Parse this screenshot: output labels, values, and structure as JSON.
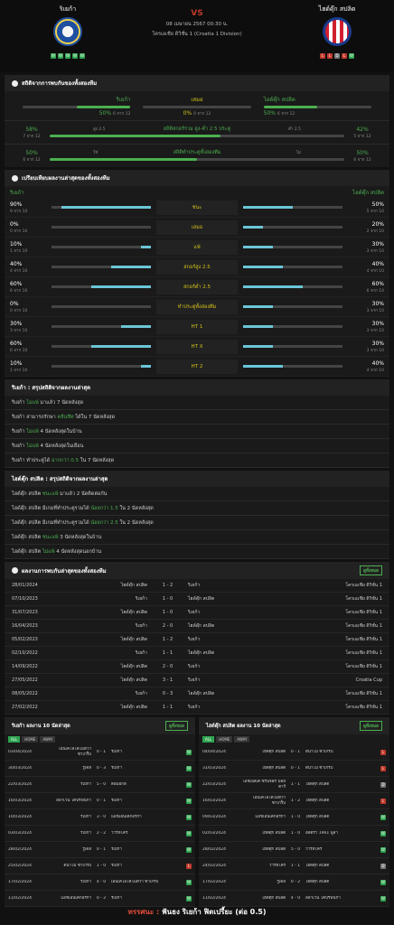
{
  "header": {
    "home": "ริเยก้า",
    "away": "ไฮด์ดุ๊ก สปลิต",
    "vs": "VS",
    "date": "08 เมษายน 2567 00:30 น.",
    "league": "โครเอเชีย ดิวิชั่น 1 (Croatia 1 Division)",
    "home_form": [
      "W",
      "W",
      "W",
      "W",
      "W"
    ],
    "away_form": [
      "L",
      "L",
      "D",
      "L",
      "W"
    ]
  },
  "h2h": {
    "title": "สถิติจากการพบกันของทั้งสองทีม",
    "labels": {
      "home": "ริเยก้า",
      "draw": "เสมอ",
      "away": "ไฮด์ดุ๊ก สปลิต"
    },
    "home_pct": "50%",
    "home_of": "6 จาก 12",
    "draw_pct": "0%",
    "draw_of": "0 จาก 12",
    "away_pct": "50%",
    "away_of": "6 จาก 12",
    "home_fill": 0.5,
    "draw_fill": 0,
    "away_fill": 0.5,
    "ou": {
      "left_pct": "58%",
      "left_of": "7 จาก 12",
      "left_lbl": "สูง 2.5",
      "center": "สถิติสกอร์รวม สูง-ต่ำ 2.5 ประตู",
      "right_lbl": "ต่ำ 2.5",
      "right_pct": "42%",
      "right_of": "5 จาก 12",
      "fill": 0.58
    },
    "bt": {
      "left_pct": "50%",
      "left_of": "6 จาก 12",
      "left_lbl": "ใช่",
      "center": "สถิติทำประตูทั้งสองทีม",
      "right_lbl": "ไม่",
      "right_pct": "50%",
      "right_of": "6 จาก 12",
      "fill": 0.5
    }
  },
  "recent": {
    "title": "เปรียบเทียบผลงานล่าสุดของทั้งสองทีม",
    "home": "ริเยก้า",
    "away": "ไฮด์ดุ๊ก สปลิต",
    "rows": [
      {
        "label": "ชนะ",
        "lp": "90%",
        "lo": "9 จาก 10",
        "lf": 0.9,
        "rp": "50%",
        "ro": "5 จาก 10",
        "rf": 0.5
      },
      {
        "label": "เสมอ",
        "lp": "0%",
        "lo": "0 จาก 10",
        "lf": 0,
        "rp": "20%",
        "ro": "2 จาก 10",
        "rf": 0.2
      },
      {
        "label": "แพ้",
        "lp": "10%",
        "lo": "1 จาก 10",
        "lf": 0.1,
        "rp": "30%",
        "ro": "3 จาก 10",
        "rf": 0.3
      },
      {
        "label": "สกอร์สูง 2.5",
        "lp": "40%",
        "lo": "4 จาก 10",
        "lf": 0.4,
        "rp": "40%",
        "ro": "4 จาก 10",
        "rf": 0.4
      },
      {
        "label": "สกอร์ต่ำ 2.5",
        "lp": "60%",
        "lo": "6 จาก 10",
        "lf": 0.6,
        "rp": "60%",
        "ro": "6 จาก 10",
        "rf": 0.6
      },
      {
        "label": "ทำประตูทั้งสองทีม",
        "lp": "0%",
        "lo": "0 จาก 10",
        "lf": 0,
        "rp": "30%",
        "ro": "3 จาก 10",
        "rf": 0.3
      },
      {
        "label": "HT 1",
        "lp": "30%",
        "lo": "3 จาก 10",
        "lf": 0.3,
        "rp": "30%",
        "ro": "3 จาก 10",
        "rf": 0.3
      },
      {
        "label": "HT X",
        "lp": "60%",
        "lo": "6 จาก 10",
        "lf": 0.6,
        "rp": "30%",
        "ro": "3 จาก 10",
        "rf": 0.3
      },
      {
        "label": "HT 2",
        "lp": "10%",
        "lo": "1 จาก 10",
        "lf": 0.1,
        "rp": "40%",
        "ro": "4 จาก 10",
        "rf": 0.4
      }
    ]
  },
  "home_summary": {
    "title": "ริเยก้า : สรุปสถิติจากผลงานล่าสุด",
    "lines": [
      [
        "ริเยก้า ",
        "ไม่แพ้",
        " มาแล้ว 7 นัดหลังสุด"
      ],
      [
        "ริเยก้า สามารถรักษา ",
        "คลีนชีท",
        " ได้ใน 7 นัดหลังสุด"
      ],
      [
        "ริเยก้า ",
        "ไม่แพ้",
        " 4 นัดหลังสุดในบ้าน"
      ],
      [
        "ริเยก้า ",
        "ไม่แพ้",
        " 4 นัดหลังสุดในเยือน"
      ],
      [
        "ริเยก้า ทำประตูได้ ",
        "มากกว่า 0.5",
        " ใน 7 นัดหลังสุด"
      ]
    ]
  },
  "away_summary": {
    "title": "ไฮด์ดุ๊ก สปลิต : สรุปสถิติจากผลงานล่าสุด",
    "lines": [
      [
        "ไฮด์ดุ๊ก สปลิต ",
        "ชนะแพ้",
        " มาแล้ว 2 นัดติดต่อกัน"
      ],
      [
        "ไฮด์ดุ๊ก สปลิต มีเกมที่ทำประตูรวมได้ ",
        "น้อยกว่า 1.5",
        " ใน 2 นัดหลังสุด"
      ],
      [
        "ไฮด์ดุ๊ก สปลิต มีเกมที่ทำประตูรวมได้ ",
        "น้อยกว่า 2.5",
        " ใน 2 นัดหลังสุด"
      ],
      [
        "ไฮด์ดุ๊ก สปลิต ",
        "ชนะแพ้",
        " 3 นัดหลังสุดในบ้าน"
      ],
      [
        "ไฮด์ดุ๊ก สปลิต ",
        "ไม่แพ้",
        " 4 นัดหลังสุดนอกบ้าน"
      ]
    ]
  },
  "meetings": {
    "title": "ผลงานการพบกันล่าสุดของทั้งสองทีม",
    "button": "ดูทั้งหมด",
    "rows": [
      [
        "28/01/2024",
        "ไฮด์ดุ๊ก สปลิต",
        "1 - 2",
        "ริเยก้า",
        "โครเอเชีย ดิวิชั่น 1"
      ],
      [
        "07/10/2023",
        "ริเยก้า",
        "1 - 0",
        "ไฮด์ดุ๊ก สปลิต",
        "โครเอเชีย ดิวิชั่น 1"
      ],
      [
        "31/07/2023",
        "ไฮด์ดุ๊ก สปลิต",
        "1 - 0",
        "ริเยก้า",
        "โครเอเชีย ดิวิชั่น 1"
      ],
      [
        "16/04/2023",
        "ริเยก้า",
        "2 - 0",
        "ไฮด์ดุ๊ก สปลิต",
        "โครเอเชีย ดิวิชั่น 1"
      ],
      [
        "05/02/2023",
        "ไฮด์ดุ๊ก สปลิต",
        "1 - 2",
        "ริเยก้า",
        "โครเอเชีย ดิวิชั่น 1"
      ],
      [
        "02/10/2022",
        "ริเยก้า",
        "1 - 1",
        "ไฮด์ดุ๊ก สปลิต",
        "โครเอเชีย ดิวิชั่น 1"
      ],
      [
        "14/09/2022",
        "ไฮด์ดุ๊ก สปลิต",
        "2 - 0",
        "ริเยก้า",
        "โครเอเชีย ดิวิชั่น 1"
      ],
      [
        "27/05/2022",
        "ไฮด์ดุ๊ก สปลิต",
        "3 - 1",
        "ริเยก้า",
        "Croatia Cup"
      ],
      [
        "08/05/2022",
        "ริเยก้า",
        "0 - 3",
        "ไฮด์ดุ๊ก สปลิต",
        "โครเอเชีย ดิวิชั่น 1"
      ],
      [
        "27/02/2022",
        "ไฮด์ดุ๊ก สปลิต",
        "1 - 1",
        "ริเยก้า",
        "โครเอเชีย ดิวิชั่น 1"
      ]
    ]
  },
  "home_last": {
    "title": "ริเยก้า ผลงาน 10 นัดล่าสุด",
    "button": "ดูทั้งหมด",
    "tabs": [
      "ALL",
      "HOME",
      "AWAY"
    ],
    "rows": [
      [
        "03/04/2024",
        "เอ็นเคโลโคโมติว่า ซาเกร็บ",
        "0 - 1",
        "ริเยก้า",
        "W"
      ],
      [
        "30/03/2024",
        "รูเดส",
        "0 - 3",
        "ริเยก้า",
        "W"
      ],
      [
        "22/03/2024",
        "ริเยก้า",
        "5 - 0",
        "ตอมอกส์",
        "W"
      ],
      [
        "16/03/2024",
        "สลาเวน โคปรีฟนิก้า",
        "0 - 1",
        "ริเยก้า",
        "W"
      ],
      [
        "10/03/2024",
        "ริเยก้า",
        "3 - 0",
        "แอชเอ็นเคกอริก้า",
        "W"
      ],
      [
        "03/03/2024",
        "ริเยก้า",
        "2 - 2",
        "วาร์ทิโคร์",
        "W"
      ],
      [
        "28/02/2024",
        "รูเดส",
        "0 - 1",
        "ริเยก้า",
        "W"
      ],
      [
        "25/02/2024",
        "ดินาโม ซาเกร็บ",
        "1 - 0",
        "ริเยก้า",
        "L"
      ],
      [
        "17/02/2024",
        "ริเยก้า",
        "4 - 0",
        "เอ็นเคโลโคโมติว่า ซาเกร็บ",
        "W"
      ],
      [
        "11/02/2024",
        "แอชเอ็นเคกอริก้า",
        "0 - 2",
        "ริเยก้า",
        "W"
      ]
    ]
  },
  "away_last": {
    "title": "ไฮด์ดุ๊ก สปลิต ผลงาน 10 นัดล่าสุด",
    "button": "ดูทั้งหมด",
    "tabs": [
      "ALL",
      "HOME",
      "AWAY"
    ],
    "rows": [
      [
        "04/04/2024",
        "ไฮด์ดุ๊ก สปลิต",
        "0 - 1",
        "ดินาโม ซาเกร็บ",
        "L"
      ],
      [
        "31/03/2024",
        "ไฮด์ดุ๊ก สปลิต",
        "0 - 1",
        "ดินาโม ซาเกร็บ",
        "L"
      ],
      [
        "22/03/2024",
        "เอชเอสเค ซรินจ์สกี้ มอสตาร์",
        "1 - 1",
        "ไฮด์ดุ๊ก สปลิต",
        "D"
      ],
      [
        "16/03/2024",
        "เอ็นเคโลโคโมติว่า ซาเกร็บ",
        "1 - 2",
        "ไฮด์ดุ๊ก สปลิต",
        "L"
      ],
      [
        "09/03/2024",
        "แอชเอ็นเคกอริก้า",
        "1 - 0",
        "ไฮด์ดุ๊ก สปลิต",
        "W"
      ],
      [
        "02/03/2024",
        "ไฮด์ดุ๊ก สปลิต",
        "1 - 0",
        "อิสตรา 1961 พูล่า",
        "W"
      ],
      [
        "28/02/2024",
        "ไฮด์ดุ๊ก สปลิต",
        "5 - 0",
        "วาร์ทิโคร์",
        "W"
      ],
      [
        "24/02/2024",
        "วาร์ทิโคร์",
        "1 - 1",
        "ไฮด์ดุ๊ก สปลิต",
        "D"
      ],
      [
        "17/02/2024",
        "รูเดส",
        "0 - 2",
        "ไฮด์ดุ๊ก สปลิต",
        "W"
      ],
      [
        "11/02/2024",
        "ไฮด์ดุ๊ก สปลิต",
        "4 - 0",
        "สลาเวน โคปรีฟนิก้า",
        "W"
      ]
    ]
  },
  "footer": {
    "prefix": "ทรรศนะ :",
    "text": " ฟันธง ริเยก้า ฟิตเปรี้ยะ (ต่อ 0.5)"
  }
}
